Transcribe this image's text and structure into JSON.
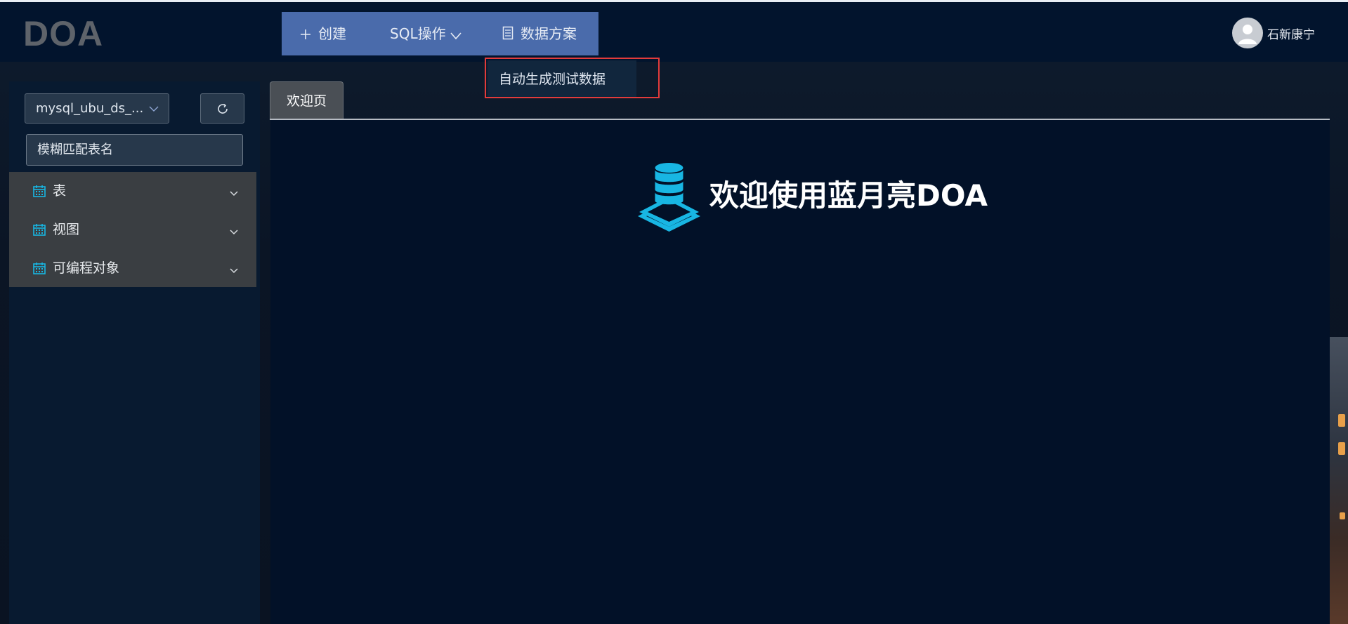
{
  "header": {
    "logo": "DOA",
    "nav": {
      "create_label": "创建",
      "sql_label": "SQL操作",
      "data_plan_label": "数据方案"
    },
    "user_name": "石新康宁"
  },
  "dropdown": {
    "item_label": "自动生成测试数据"
  },
  "sidebar": {
    "db_select_value": "mysql_ubu_ds_...",
    "search_placeholder": "模糊匹配表名",
    "tree": [
      {
        "label": "表"
      },
      {
        "label": "视图"
      },
      {
        "label": "可编程对象"
      }
    ]
  },
  "tabs": [
    {
      "label": "欢迎页"
    }
  ],
  "main": {
    "welcome_text": "欢迎使用蓝月亮DOA"
  },
  "colors": {
    "header_bg": "#02142d",
    "nav_bg": "#4a6bab",
    "accent_cyan": "#18b6e3",
    "highlight_red": "#e23b3b"
  },
  "icons": {
    "create": "plus-icon",
    "sql": "chevron-down-icon",
    "data_plan": "document-icon",
    "refresh": "refresh-icon",
    "tree_item": "calendar-icon",
    "welcome": "database-icon"
  }
}
